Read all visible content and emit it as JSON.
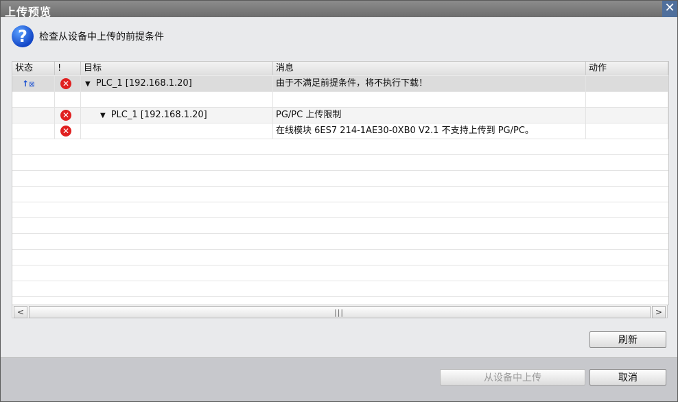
{
  "window": {
    "title": "上传预览",
    "close_label": "✕"
  },
  "header": {
    "text": "检查从设备中上传的前提条件"
  },
  "table": {
    "columns": [
      "状态",
      "!",
      "目标",
      "消息",
      "动作"
    ],
    "rows": [
      {
        "status": "↑",
        "error": "✕",
        "target": "PLC_1 [192.168.1.20]",
        "message": "由于不满足前提条件，将不执行下载！"
      },
      {
        "status": "",
        "error": "",
        "target": "",
        "message": ""
      },
      {
        "status": "",
        "error": "✕",
        "target": "PLC_1 [192.168.1.20]",
        "message": "PG/PC 上传限制"
      },
      {
        "status": "",
        "error": "✕",
        "target": "",
        "message": "在线模块 6ES7 214-1AE30-0XB0 V2.1 不支持上传到 PG/PC。"
      }
    ]
  },
  "scroll": {
    "left": "<",
    "right": ">",
    "grip": "|||"
  },
  "buttons": {
    "refresh": "刷新",
    "upload": "从设备中上传",
    "cancel": "取消"
  },
  "colors": {
    "title_bar": "#7b7b7b",
    "close_button": "#4f6f9c",
    "error_red": "#e02020",
    "question_blue": "#1347c7"
  },
  "icons": {
    "question": "question-mark-icon",
    "error": "error-x-icon",
    "status": "upload-status-icon"
  }
}
